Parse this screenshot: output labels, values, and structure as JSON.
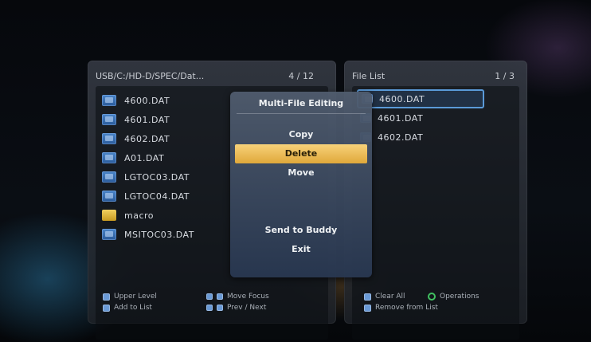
{
  "left_panel": {
    "path": "USB/C:/HD-D/SPEC/Dat...",
    "page": "4 / 12",
    "files": [
      {
        "name": "4600.DAT",
        "type": "file"
      },
      {
        "name": "4601.DAT",
        "type": "file"
      },
      {
        "name": "4602.DAT",
        "type": "file"
      },
      {
        "name": "A01.DAT",
        "type": "file"
      },
      {
        "name": "LGTOC03.DAT",
        "type": "file"
      },
      {
        "name": "LGTOC04.DAT",
        "type": "file"
      },
      {
        "name": "macro",
        "type": "folder"
      },
      {
        "name": "MSITOC03.DAT",
        "type": "file"
      }
    ]
  },
  "right_panel": {
    "title": "File List",
    "page": "1 / 3",
    "files": [
      {
        "name": "4600.DAT",
        "focused": true
      },
      {
        "name": "4601.DAT",
        "focused": false
      },
      {
        "name": "4602.DAT",
        "focused": false
      }
    ]
  },
  "popup": {
    "title": "Multi-File Editing",
    "items": [
      {
        "label": "Copy",
        "state": "normal"
      },
      {
        "label": "Delete",
        "state": "selected"
      },
      {
        "label": "Move",
        "state": "normal"
      },
      {
        "label": "",
        "state": "disabled"
      },
      {
        "label": "",
        "state": "disabled"
      },
      {
        "label": "Send to Buddy",
        "state": "normal"
      },
      {
        "label": "Exit",
        "state": "normal"
      }
    ]
  },
  "footer": {
    "upper_level": "Upper Level",
    "add_to_list": "Add to List",
    "move_focus": "Move Focus",
    "prev_next": "Prev / Next",
    "clear_all": "Clear All",
    "operations": "Operations",
    "remove_from_list": "Remove from List"
  },
  "colors": {
    "selected_menu": "#e8b850",
    "focus_border": "#5a9ad8",
    "file_icon": "#3a74b8",
    "folder_icon": "#e0b840",
    "operations_key": "#40c060"
  },
  "icons": {
    "file": "data-file-icon",
    "folder": "folder-icon",
    "back_key": "back-key-icon",
    "nav_keys": "arrow-keys-icon",
    "clear_key": "blue-key-icon",
    "operations_key": "green-ring-key-icon"
  }
}
